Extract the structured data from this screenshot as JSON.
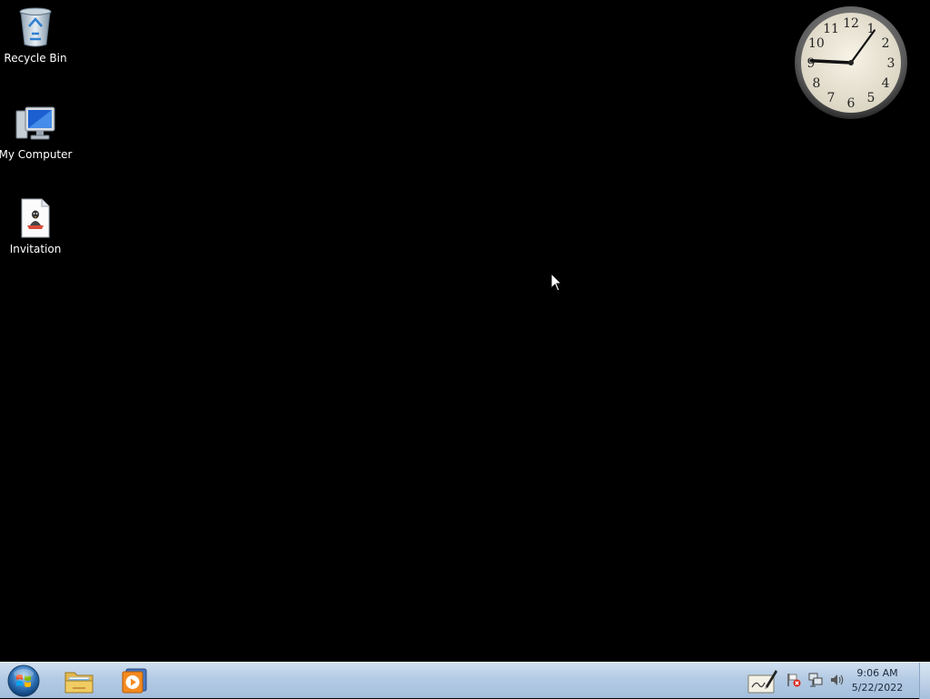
{
  "desktop": {
    "icons": [
      {
        "label": "Recycle Bin",
        "icon": "recycle-bin-icon"
      },
      {
        "label": "My Computer",
        "icon": "computer-icon"
      },
      {
        "label": "Invitation",
        "icon": "document-icon"
      }
    ],
    "clock_gadget": {
      "numbers": [
        "12",
        "1",
        "2",
        "3",
        "4",
        "5",
        "6",
        "7",
        "8",
        "9",
        "10",
        "11"
      ],
      "hour": 9,
      "minute": 6
    }
  },
  "taskbar": {
    "start_icon": "windows-orb-icon",
    "pinned": [
      {
        "icon": "file-explorer-icon"
      },
      {
        "icon": "media-player-icon"
      }
    ],
    "tray": {
      "icons": [
        "pen-input-icon",
        "action-center-flag-icon",
        "network-icon",
        "volume-icon"
      ],
      "time": "9:06 AM",
      "date": "5/22/2022"
    }
  },
  "colors": {
    "desktop_background": "#000000",
    "taskbar_top": "#cfdff0",
    "taskbar_bottom": "#a4bedc"
  }
}
